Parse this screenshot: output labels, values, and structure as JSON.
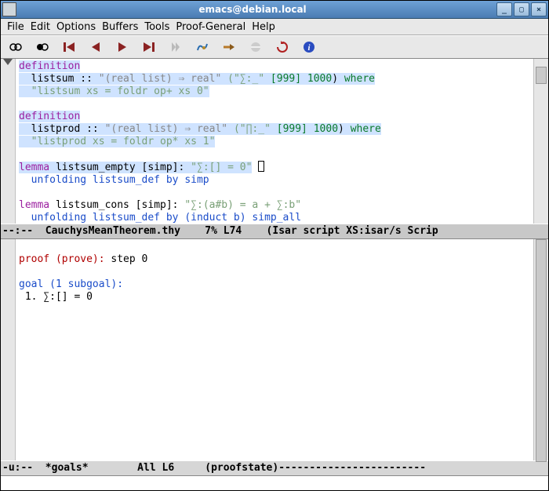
{
  "window": {
    "title": "emacs@debian.local"
  },
  "menubar": {
    "items": [
      "File",
      "Edit",
      "Options",
      "Buffers",
      "Tools",
      "Proof-General",
      "Help"
    ]
  },
  "toolbar": {
    "icons": [
      {
        "name": "show-state-icon"
      },
      {
        "name": "show-context-icon"
      },
      {
        "name": "undo-step-icon"
      },
      {
        "name": "step-back-icon"
      },
      {
        "name": "step-forward-icon"
      },
      {
        "name": "use-point-icon"
      },
      {
        "name": "goto-icon",
        "disabled": true
      },
      {
        "name": "find-icon"
      },
      {
        "name": "command-icon"
      },
      {
        "name": "interrupt-icon",
        "disabled": true
      },
      {
        "name": "restart-icon"
      },
      {
        "name": "info-icon"
      }
    ]
  },
  "buffer_top": {
    "line1_kw": "definition",
    "line2_pre": "  listsum :: ",
    "line2_ty": "\"(real list) ⇒ real\"",
    "line2_sym": " (\"∑:_\" ",
    "line2_nums": "[999] 1000",
    "line2_close": ") ",
    "line2_where": "where",
    "line3": "  \"listsum xs = foldr op+ xs 0\"",
    "line5_kw": "definition",
    "line6_pre": "  listprod :: ",
    "line6_ty": "\"(real list) ⇒ real\"",
    "line6_sym": " (\"∏:_\" ",
    "line6_nums": "[999] 1000",
    "line6_close": ") ",
    "line6_where": "where",
    "line7": "  \"listprod xs = foldr op* xs 1\"",
    "line9_kw": "lemma",
    "line9_name": " listsum_empty ",
    "line9_attr": "[simp]: ",
    "line9_goal": "\"∑:[] = 0\"",
    "line10": "  unfolding listsum_def by simp",
    "line12_kw": "lemma",
    "line12_name": " listsum_cons ",
    "line12_attr": "[simp]: ",
    "line12_goal": "\"∑:(a#b) = a + ∑:b\"",
    "line13": "  unfolding listsum_def by (induct b) simp_all"
  },
  "modeline_top": "--:--  CauchysMeanTheorem.thy    7% L74    (Isar script XS:isar/s Scrip",
  "buffer_bot": {
    "l1a": "proof (prove): ",
    "l1b": "step 0",
    "l3": "goal (1 subgoal):",
    "l4": " 1. ∑:[] = 0"
  },
  "modeline_bot": "-u:--  *goals*        All L6     (proofstate)------------------------",
  "echo": ""
}
